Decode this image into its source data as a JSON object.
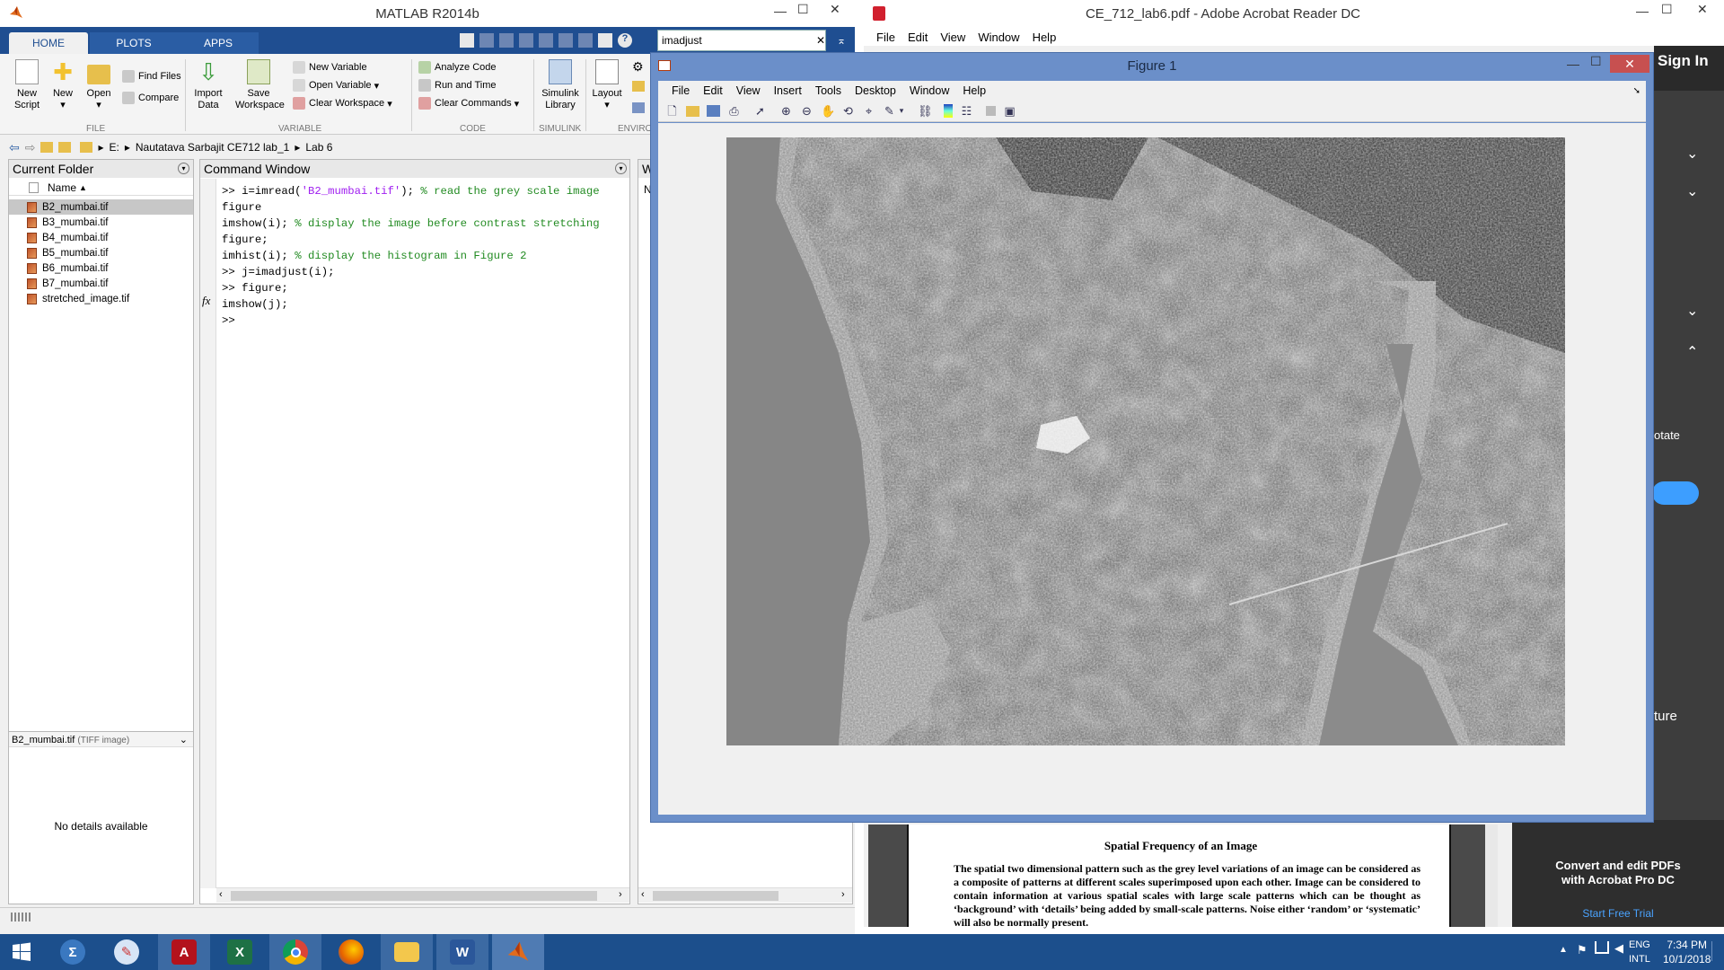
{
  "acrobat": {
    "title": "CE_712_lab6.pdf - Adobe Acrobat Reader DC",
    "menu": [
      "File",
      "Edit",
      "View",
      "Window",
      "Help"
    ],
    "sign_in": "Sign In",
    "side_labels": {
      "rotate": "otate",
      "feature": "ture"
    },
    "promo_line1": "Convert and edit PDFs",
    "promo_line2": "with Acrobat Pro DC",
    "promo_link": "Start Free Trial",
    "doc_heading": "Spatial Frequency of an Image",
    "doc_body": "The spatial two dimensional pattern such as the grey level variations of an image can be considered as a composite of patterns at different scales superimposed upon each other. Image can be considered to contain information at various spatial scales with large scale patterns which can be thought as ‘background’ with ‘details’ being added by small-scale patterns. Noise either ‘random’ or ‘systematic’ will also be normally present."
  },
  "matlab": {
    "title": "MATLAB R2014b",
    "tabs": [
      "HOME",
      "PLOTS",
      "APPS"
    ],
    "search_value": "imadjust",
    "ribbon": {
      "new_script": "New\nScript",
      "new": "New",
      "open": "Open",
      "find_files": "Find Files",
      "compare": "Compare",
      "import_data": "Import\nData",
      "save_workspace": "Save\nWorkspace",
      "new_variable": "New Variable",
      "open_variable": "Open Variable",
      "clear_workspace": "Clear Workspace",
      "analyze_code": "Analyze Code",
      "run_and_time": "Run and Time",
      "clear_commands": "Clear Commands",
      "simulink_library": "Simulink\nLibrary",
      "layout": "Layout",
      "sections": [
        "FILE",
        "VARIABLE",
        "CODE",
        "SIMULINK",
        "ENVIRO"
      ]
    },
    "address": [
      "E:",
      "Nautatava Sarbajit CE712 lab_1",
      "Lab 6"
    ],
    "current_folder": {
      "title": "Current Folder",
      "column": "Name",
      "files": [
        "B2_mumbai.tif",
        "B3_mumbai.tif",
        "B4_mumbai.tif",
        "B5_mumbai.tif",
        "B6_mumbai.tif",
        "B7_mumbai.tif",
        "stretched_image.tif"
      ],
      "selected_name": "B2_mumbai.tif",
      "selected_type": "(TIFF image)",
      "no_details": "No details available"
    },
    "command_window": {
      "title": "Command Window",
      "prompt": ">>",
      "fx": "fx"
    },
    "workspace_header": "W",
    "workspace_letter": "N"
  },
  "figure": {
    "title": "Figure 1",
    "menu": [
      "File",
      "Edit",
      "View",
      "Insert",
      "Tools",
      "Desktop",
      "Window",
      "Help"
    ]
  },
  "taskbar": {
    "time": "7:34 PM",
    "date": "10/1/2018",
    "lang": "ENG",
    "layout": "INTL"
  }
}
